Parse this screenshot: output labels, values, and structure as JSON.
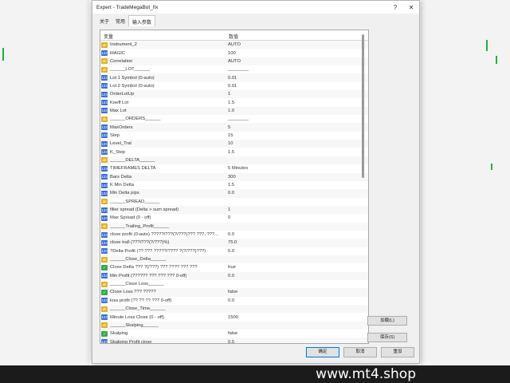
{
  "window": {
    "title": "Expert - TradeMegaBot_fix",
    "help_label": "?",
    "close_label": "✕"
  },
  "tabs": [
    {
      "label": "关于"
    },
    {
      "label": "常用"
    },
    {
      "label": "输入参数"
    }
  ],
  "table": {
    "headers": {
      "variable": "变量",
      "value": "数值"
    },
    "rows": [
      {
        "icon": "ab",
        "name": "Instrument_2",
        "value": "AUTO"
      },
      {
        "icon": "num",
        "name": "MAGIC",
        "value": "100"
      },
      {
        "icon": "ab",
        "name": "Correlation",
        "value": "AUTO"
      },
      {
        "icon": "ab",
        "name": "______LOT______",
        "value": "________"
      },
      {
        "icon": "num",
        "name": "Lot 1 Symbol (0-auto)",
        "value": "0.01"
      },
      {
        "icon": "num",
        "name": "Lot 2 Symbol (0-auto)",
        "value": "0.01"
      },
      {
        "icon": "num",
        "name": "OrderLotUp",
        "value": "1"
      },
      {
        "icon": "num",
        "name": "Koeff Lot",
        "value": "1.5"
      },
      {
        "icon": "num",
        "name": "Max Lot",
        "value": "1.0"
      },
      {
        "icon": "ab",
        "name": "______ORDERS______",
        "value": "________"
      },
      {
        "icon": "num",
        "name": "MaxOrders",
        "value": "5"
      },
      {
        "icon": "num",
        "name": "Step",
        "value": "15"
      },
      {
        "icon": "num",
        "name": "Level_Tral",
        "value": "10"
      },
      {
        "icon": "num",
        "name": "K_Step",
        "value": "1.5"
      },
      {
        "icon": "ab",
        "name": "______DELTA______",
        "value": ""
      },
      {
        "icon": "num",
        "name": "TIMEFRAMES DELTA",
        "value": "5 Minutes"
      },
      {
        "icon": "num",
        "name": "Bars Delta",
        "value": "300"
      },
      {
        "icon": "num",
        "name": "K Min Delta",
        "value": "1.5"
      },
      {
        "icon": "num",
        "name": "Min Delta pips",
        "value": "0.0"
      },
      {
        "icon": "ab",
        "name": "______SPREAD______",
        "value": ""
      },
      {
        "icon": "num",
        "name": "filter spread (Delta > sum spread)",
        "value": "1"
      },
      {
        "icon": "num",
        "name": "Max Spread (0 - off)",
        "value": "0"
      },
      {
        "icon": "ab",
        "name": "______Trailing_Profit______",
        "value": ""
      },
      {
        "icon": "num",
        "name": "close profit (0-auto) ?????/???(?/???)??? ???, ???...",
        "value": "0.0"
      },
      {
        "icon": "num",
        "name": "close trall (???/???(?/???)%)",
        "value": "75.0"
      },
      {
        "icon": "num",
        "name": "?Delta Profit (?? ???  ?????/???? ?(?/???)???)",
        "value": "5.0"
      },
      {
        "icon": "ab",
        "name": "______Close_Delta______",
        "value": ""
      },
      {
        "icon": "bool",
        "name": "Close Delta ???  ?(/???) ??? ???? ??? ???",
        "value": "true"
      },
      {
        "icon": "num",
        "name": "Min Profit (?????? ???  ??? ??? 0-off)",
        "value": "0.0"
      },
      {
        "icon": "ab",
        "name": "______Close Loss______",
        "value": ""
      },
      {
        "icon": "bool",
        "name": "Close Loss ???  ?????",
        "value": "false"
      },
      {
        "icon": "num",
        "name": "loss profit (?? ?? ?? ??? 0-off)",
        "value": "0.0"
      },
      {
        "icon": "ab",
        "name": "______Close_Time______",
        "value": ""
      },
      {
        "icon": "num",
        "name": "Minute Loss Close (0 - off)",
        "value": "1500"
      },
      {
        "icon": "ab",
        "name": "______Skalping______",
        "value": ""
      },
      {
        "icon": "bool",
        "name": "Skalping",
        "value": "false"
      },
      {
        "icon": "num",
        "name": "Skalping Profit close",
        "value": "0.5"
      }
    ]
  },
  "side_buttons": {
    "load": "加载(L)",
    "save": "保存(S)"
  },
  "bottom_buttons": {
    "ok": "确定",
    "cancel": "取消",
    "reset": "重设"
  },
  "watermark": "www.mt4.shop",
  "colors": {
    "icon_text": "#e0b020",
    "icon_number": "#3a6fd0",
    "icon_bool": "#38a852",
    "chart_candle": "#1fb23a"
  }
}
